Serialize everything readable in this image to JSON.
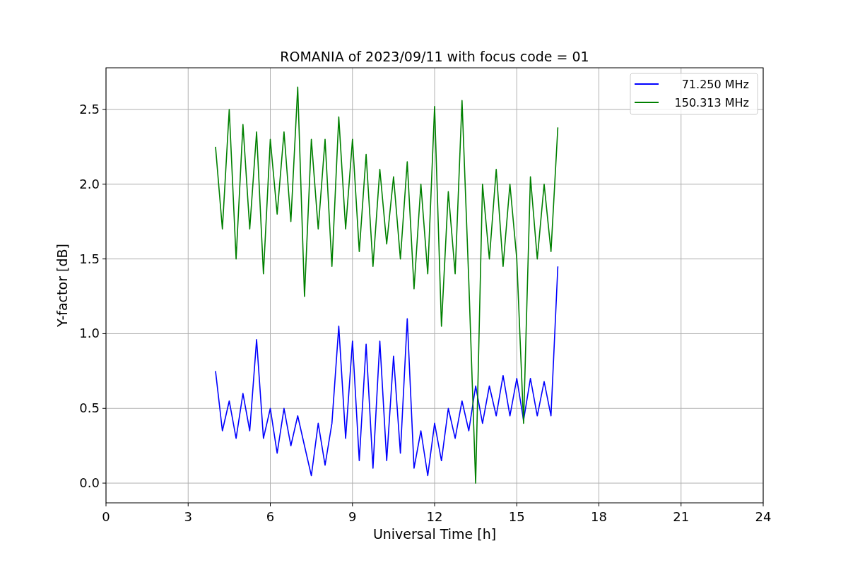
{
  "chart_data": {
    "type": "line",
    "title": "ROMANIA of 2023/09/11 with focus code = 01",
    "xlabel": "Universal Time [h]",
    "ylabel": "Y-factor [dB]",
    "grid": true,
    "legend": true,
    "xlim": [
      0,
      24
    ],
    "ylim": [
      -0.132,
      2.779
    ],
    "xticks": [
      0,
      3,
      6,
      9,
      12,
      15,
      18,
      21,
      24
    ],
    "yticks": [
      {
        "value": 0,
        "label": "0.0"
      },
      {
        "value": 0.5,
        "label": "0.5"
      },
      {
        "value": 1,
        "label": "1.0"
      },
      {
        "value": 1.5,
        "label": "1.5"
      },
      {
        "value": 2,
        "label": "2.0"
      },
      {
        "value": 2.5,
        "label": "2.5"
      }
    ],
    "x": [
      4.0,
      4.25,
      4.5,
      4.75,
      5.0,
      5.25,
      5.5,
      5.75,
      6.0,
      6.25,
      6.5,
      6.75,
      7.0,
      7.25,
      7.5,
      7.75,
      8.0,
      8.25,
      8.5,
      8.75,
      9.0,
      9.25,
      9.5,
      9.75,
      10.0,
      10.25,
      10.5,
      10.75,
      11.0,
      11.25,
      11.5,
      11.75,
      12.0,
      12.25,
      12.5,
      12.75,
      13.0,
      13.25,
      13.5,
      13.75,
      14.0,
      14.25,
      14.5,
      14.75,
      15.0,
      15.25,
      15.5,
      15.75,
      16.0,
      16.25,
      16.5
    ],
    "series": [
      {
        "name": "71.250 MHz",
        "color": "#0000ff",
        "values": [
          0.75,
          0.35,
          0.55,
          0.3,
          0.6,
          0.35,
          0.96,
          0.3,
          0.5,
          0.2,
          0.5,
          0.25,
          0.45,
          0.25,
          0.05,
          0.4,
          0.12,
          0.4,
          1.05,
          0.3,
          0.95,
          0.15,
          0.93,
          0.1,
          0.95,
          0.15,
          0.85,
          0.2,
          1.1,
          0.1,
          0.35,
          0.05,
          0.4,
          0.15,
          0.5,
          0.3,
          0.55,
          0.35,
          0.65,
          0.4,
          0.65,
          0.45,
          0.72,
          0.45,
          0.7,
          0.42,
          0.7,
          0.45,
          0.68,
          0.45,
          1.45
        ]
      },
      {
        "name": "150.313 MHz",
        "color": "#008000",
        "values": [
          2.25,
          1.7,
          2.5,
          1.5,
          2.4,
          1.7,
          2.35,
          1.4,
          2.3,
          1.8,
          2.35,
          1.75,
          2.65,
          1.25,
          2.3,
          1.7,
          2.3,
          1.45,
          2.45,
          1.7,
          2.3,
          1.55,
          2.2,
          1.45,
          2.1,
          1.6,
          2.05,
          1.5,
          2.15,
          1.3,
          2.0,
          1.4,
          2.52,
          1.05,
          1.95,
          1.4,
          2.56,
          1.35,
          0.0,
          2.0,
          1.5,
          2.1,
          1.45,
          2.0,
          1.5,
          0.4,
          2.05,
          1.5,
          2.0,
          1.55,
          2.38
        ]
      }
    ]
  }
}
